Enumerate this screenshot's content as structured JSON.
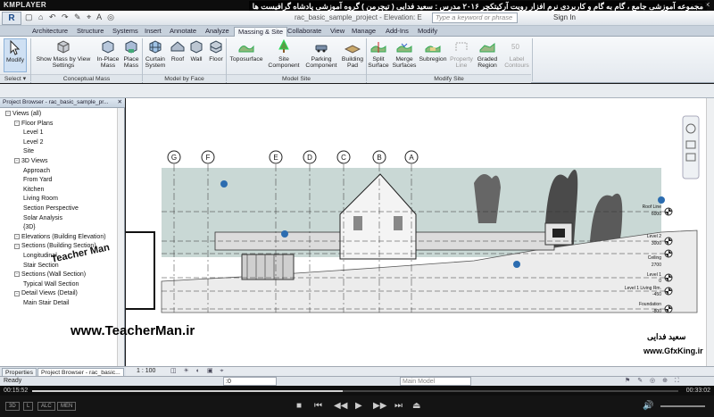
{
  "player": {
    "name": "KMPLAYER",
    "window_controls": "- ▭ ✕",
    "elapsed": "00:15:52",
    "total": "00:33:02",
    "progress": 0.48,
    "badges": [
      "3D",
      "L",
      "ALC",
      "MEN"
    ],
    "watermark_url": "www.TeacherMan.ir",
    "logo_text": "Teacher Man",
    "gfx_url": "www.GfxKing.ir",
    "persian_name": "سعید فدایی"
  },
  "overlay_title": "مجموعه آموزشی جامع ، گام به گام و کاربردی نرم افزار رویت آرکیتکچر ۲۰۱۶ مدرس : سعید فدایی ( تیچرمن ) گروه آموزشی پادشاه گرافیست ها",
  "titlebar": {
    "app_letter": "R",
    "quick_access": "▢ ⌂ ↶ ↷ ✎ ⌖ A ◎",
    "document": "rac_basic_sample_project - Elevation: E",
    "search_placeholder": "Type a keyword or phrase",
    "sign_in": "Sign In"
  },
  "tabs": [
    "Architecture",
    "Structure",
    "Systems",
    "Insert",
    "Annotate",
    "Analyze",
    "Massing & Site",
    "Collaborate",
    "View",
    "Manage",
    "Add-Ins",
    "Modify"
  ],
  "active_tab": "Massing & Site",
  "ribbon": {
    "modify": "Modify",
    "select": "Select ▾",
    "conceptual_mass": {
      "label": "Conceptual Mass",
      "buttons": [
        "Show Mass by View Settings",
        "In-Place Mass",
        "Place Mass"
      ]
    },
    "model_by_face": {
      "label": "Model by Face",
      "buttons": [
        "Curtain System",
        "Roof",
        "Wall",
        "Floor"
      ]
    },
    "model_site": {
      "label": "Model Site",
      "buttons": [
        "Toposurface",
        "Site Component",
        "Parking Component",
        "Building Pad"
      ]
    },
    "modify_site": {
      "label": "Modify Site",
      "buttons": [
        "Split Surface",
        "Merge Surfaces",
        "Subregion",
        "Property Line",
        "Graded Region",
        "Label Contours"
      ]
    }
  },
  "project_browser": {
    "title": "Project Browser - rac_basic_sample_pr...",
    "items": [
      {
        "label": "Views (all)",
        "level": 0,
        "toggle": "-"
      },
      {
        "label": "Floor Plans",
        "level": 1,
        "toggle": "-"
      },
      {
        "label": "Level 1",
        "level": 2,
        "toggle": ""
      },
      {
        "label": "Level 2",
        "level": 2,
        "toggle": ""
      },
      {
        "label": "Site",
        "level": 2,
        "toggle": ""
      },
      {
        "label": "3D Views",
        "level": 1,
        "toggle": "-"
      },
      {
        "label": "Approach",
        "level": 2,
        "toggle": ""
      },
      {
        "label": "From Yard",
        "level": 2,
        "toggle": ""
      },
      {
        "label": "Kitchen",
        "level": 2,
        "toggle": ""
      },
      {
        "label": "Living Room",
        "level": 2,
        "toggle": ""
      },
      {
        "label": "Section Perspective",
        "level": 2,
        "toggle": ""
      },
      {
        "label": "Solar Analysis",
        "level": 2,
        "toggle": ""
      },
      {
        "label": "{3D}",
        "level": 2,
        "toggle": ""
      },
      {
        "label": "Elevations (Building Elevation)",
        "level": 1,
        "toggle": "-"
      },
      {
        "label": "Sections (Building Section)",
        "level": 1,
        "toggle": "-"
      },
      {
        "label": "Longitudinal",
        "level": 2,
        "toggle": ""
      },
      {
        "label": "Stair Section",
        "level": 2,
        "toggle": ""
      },
      {
        "label": "Sections (Wall Section)",
        "level": 1,
        "toggle": "-"
      },
      {
        "label": "Typical Wall Section",
        "level": 2,
        "toggle": ""
      },
      {
        "label": "Detail Views (Detail)",
        "level": 1,
        "toggle": "-"
      },
      {
        "label": "Main Stair Detail",
        "level": 2,
        "toggle": ""
      }
    ]
  },
  "bottom_tabs": [
    "Properties",
    "Project Browser - rac_basic..."
  ],
  "canvas": {
    "grids": [
      "G",
      "F",
      "E",
      "D",
      "C",
      "B",
      "A"
    ],
    "levels": [
      {
        "name": "Roof Line",
        "value": "6000"
      },
      {
        "name": "Level 2",
        "value": "3000"
      },
      {
        "name": "Ceiling",
        "value": "2700"
      },
      {
        "name": "Level 1",
        "value": "0"
      },
      {
        "name": "Level 1 Living Rm.",
        "value": "-450"
      },
      {
        "name": "Foundation",
        "value": "-800"
      }
    ]
  },
  "view_scale": "1 : 100",
  "status": {
    "left": "Ready",
    "workset": ":0",
    "model": "Main Model"
  },
  "colors": {
    "accent": "#2b6cb0",
    "ribbon_bg": "#e9edf2",
    "sky": "#c9d8d5"
  }
}
